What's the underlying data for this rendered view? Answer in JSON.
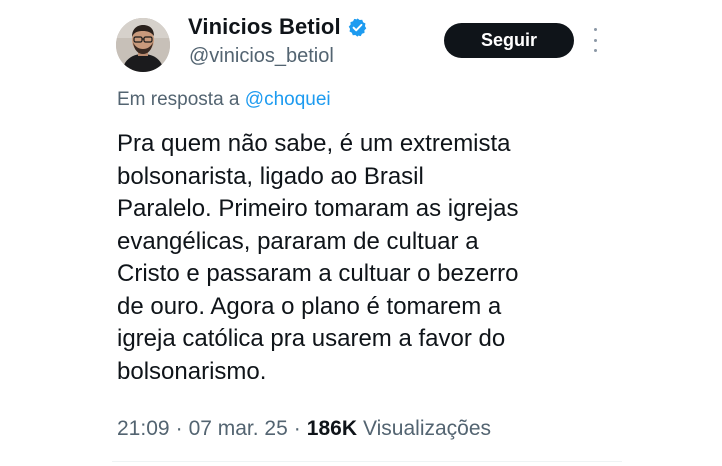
{
  "author": {
    "name": "Vinicios Betiol",
    "handle": "@vinicios_betiol",
    "verified_icon": "verified-badge-icon",
    "avatar_icon": "avatar"
  },
  "actions": {
    "follow_label": "Seguir",
    "more_icon": "more-options-icon"
  },
  "reply": {
    "prefix": "Em resposta a ",
    "mention": "@choquei"
  },
  "tweet": {
    "text": "Pra quem não sabe, é um extremista\nbolsonarista, ligado ao Brasil\nParalelo. Primeiro tomaram as igrejas\nevangélicas, pararam de cultuar a\nCristo e passaram a cultuar o bezerro\nde ouro. Agora o plano é tomarem a\nigreja católica pra usarem a favor do\nbolsonarismo."
  },
  "meta": {
    "time": "21:09",
    "separator": "·",
    "date": "07 mar. 25",
    "views_count": "186K",
    "views_label": "Visualizações"
  },
  "colors": {
    "text": "#0f1419",
    "secondary": "#536471",
    "link": "#1d9bf0",
    "button_bg": "#0f1419",
    "verified": "#1d9bf0"
  }
}
